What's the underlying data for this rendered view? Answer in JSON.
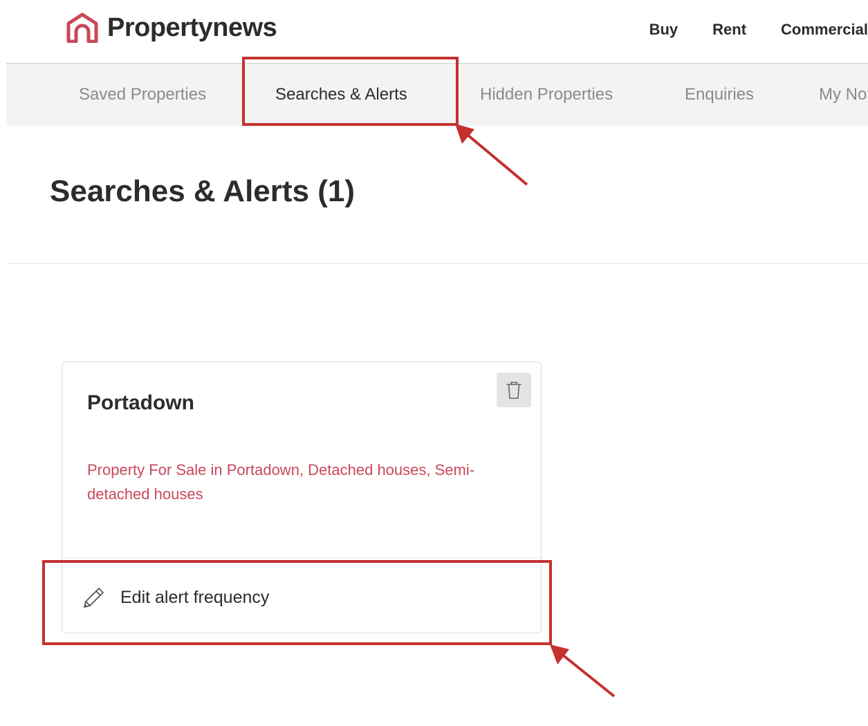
{
  "header": {
    "logo_text": "Propertynews",
    "logo_icon": "house-icon",
    "nav": [
      "Buy",
      "Rent",
      "Commercial"
    ]
  },
  "tabs": [
    {
      "label": "Saved Properties",
      "active": false
    },
    {
      "label": "Searches & Alerts",
      "active": true
    },
    {
      "label": "Hidden Properties",
      "active": false
    },
    {
      "label": "Enquiries",
      "active": false
    },
    {
      "label": "My Notes",
      "active": false
    }
  ],
  "main": {
    "title": "Searches & Alerts (1)"
  },
  "alert_card": {
    "title": "Portadown",
    "description": "Property For Sale in Portadown, Detached houses, Semi-detached houses",
    "delete_icon": "trash-icon",
    "edit_icon": "pencil-icon",
    "edit_label": "Edit alert frequency"
  },
  "colors": {
    "brand": "#c8485a",
    "annotation": "#c4312f",
    "text": "#2c2c2c",
    "tab_bar_bg": "#f3f3f3"
  }
}
